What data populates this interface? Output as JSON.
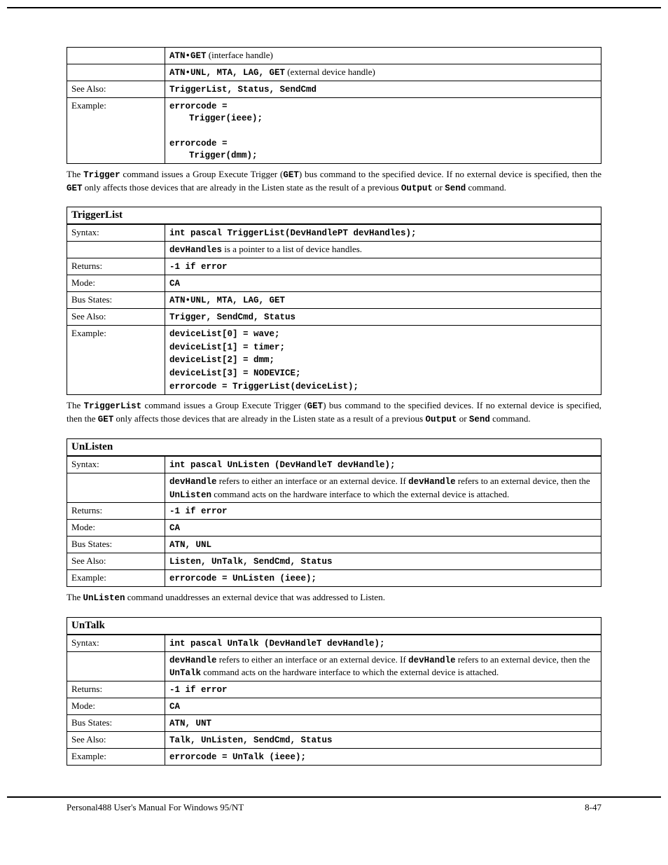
{
  "footer": {
    "left": "Personal488 User's Manual For Windows 95/NT",
    "right": "8-47"
  },
  "t1": {
    "r1a": "ATN•GET",
    "r1b": "  (interface handle)",
    "r2a": "ATN•UNL, MTA, LAG, GET",
    "r2b": "  (external device handle)",
    "see_label": "See Also:",
    "see": "TriggerList, Status, SendCmd",
    "ex_label": "Example:",
    "ex1a": "errorcode =",
    "ex1b": "Trigger(ieee);",
    "ex2a": "errorcode =",
    "ex2b": "Trigger(dmm);"
  },
  "p1": {
    "a": "The ",
    "b": "Trigger",
    "c": " command issues a Group Execute Trigger (",
    "d": "GET",
    "e": ") bus command to the specified device.  If no external device is specified, then the ",
    "f": "GET",
    "g": " only affects those devices that are already in the Listen state as the result of a previous ",
    "h": "Output",
    "i": " or ",
    "j": "Send",
    "k": " command."
  },
  "t2": {
    "title": "TriggerList",
    "syntax_label": "Syntax:",
    "syntax": "int pascal TriggerList(DevHandlePT devHandles);",
    "devh_b": "devHandles",
    "devh_txt": " is a pointer to a list of device handles.",
    "ret_label": "Returns:",
    "ret": "-1 if error",
    "mode_label": "Mode:",
    "mode": "CA",
    "bus_label": "Bus States:",
    "bus": "ATN•UNL, MTA, LAG, GET",
    "see_label": "See Also:",
    "see": "Trigger, SendCmd, Status",
    "ex_label": "Example:",
    "ex1": "deviceList[0] = wave;",
    "ex2": "deviceList[1] = timer;",
    "ex3": "deviceList[2] = dmm;",
    "ex4": "deviceList[3] = NODEVICE;",
    "ex5": "errorcode = TriggerList(deviceList);"
  },
  "p2": {
    "a": "The ",
    "b": "TriggerList",
    "c": " command issues a Group Execute Trigger (",
    "d": "GET",
    "e": ") bus command to the specified devices.  If no external device is specified, then the ",
    "f": "GET",
    "g": " only affects those devices that are already in the Listen state as a result of a previous ",
    "h": "Output",
    "i": " or ",
    "j": "Send",
    "k": " command."
  },
  "t3": {
    "title": "UnListen",
    "syntax_label": "Syntax:",
    "syntax": "int pascal UnListen (DevHandleT devHandle);",
    "dev_b": "devHandle",
    "dev_txt1": " refers to either an interface or an external device.  If ",
    "dev_b2": "devHandle",
    "dev_txt2": " refers to an external device, then the ",
    "dev_b3": "UnListen",
    "dev_txt3": " command acts on the hardware interface to which the external device is attached.",
    "ret_label": "Returns:",
    "ret": "-1 if error",
    "mode_label": "Mode:",
    "mode": "CA",
    "bus_label": "Bus States:",
    "bus": "ATN, UNL",
    "see_label": "See Also:",
    "see": "Listen, UnTalk, SendCmd, Status",
    "ex_label": "Example:",
    "ex": "errorcode = UnListen (ieee);"
  },
  "p3": {
    "a": "The ",
    "b": "UnListen",
    "c": " command unaddresses an external device that was addressed to Listen."
  },
  "t4": {
    "title": "UnTalk",
    "syntax_label": "Syntax:",
    "syntax": "int pascal UnTalk (DevHandleT devHandle);",
    "dev_b": "devHandle",
    "dev_txt1": " refers to either an interface or an external device.  If ",
    "dev_b2": "devHandle",
    "dev_txt2": " refers to an external device, then the ",
    "dev_b3": "UnTalk",
    "dev_txt3": " command acts on the hardware interface to which the external device is attached.",
    "ret_label": "Returns:",
    "ret": "-1 if error",
    "mode_label": "Mode:",
    "mode": "CA",
    "bus_label": "Bus States:",
    "bus": "ATN, UNT",
    "see_label": "See Also:",
    "see": "Talk, UnListen, SendCmd, Status",
    "ex_label": "Example:",
    "ex": "errorcode = UnTalk (ieee);"
  }
}
